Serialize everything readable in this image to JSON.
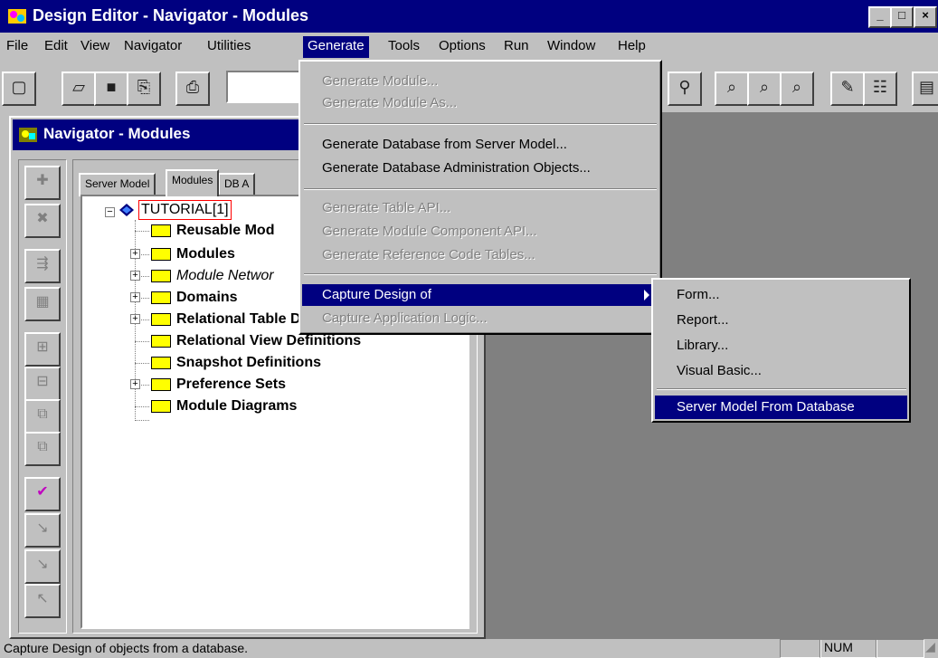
{
  "window": {
    "title": "Design Editor - Navigator - Modules",
    "caption_buttons": {
      "minimize": "_",
      "maximize": "□",
      "close": "×"
    }
  },
  "menubar": [
    {
      "label": "File"
    },
    {
      "label": "Edit"
    },
    {
      "label": "View"
    },
    {
      "label": "Navigator"
    },
    {
      "label": "Utilities"
    },
    {
      "label": "Generate"
    },
    {
      "label": "Tools"
    },
    {
      "label": "Options"
    },
    {
      "label": "Run"
    },
    {
      "label": "Window"
    },
    {
      "label": "Help"
    }
  ],
  "navigator": {
    "title": "Navigator - Modules",
    "tabs": [
      {
        "label": "Server Model"
      },
      {
        "label": "Modules"
      },
      {
        "label": "DB A"
      }
    ],
    "tree": {
      "root": "TUTORIAL[1]",
      "items": [
        {
          "label": "Reusable Mod"
        },
        {
          "label": "Modules"
        },
        {
          "label": "Module Networ"
        },
        {
          "label": "Domains"
        },
        {
          "label": "Relational Table Definitions"
        },
        {
          "label": "Relational View Definitions"
        },
        {
          "label": "Snapshot Definitions"
        },
        {
          "label": "Preference Sets"
        },
        {
          "label": "Module Diagrams"
        }
      ]
    }
  },
  "generate_menu": {
    "items": [
      {
        "label": "Generate Module...",
        "enabled": false
      },
      {
        "label": "Generate Module As...",
        "enabled": false
      },
      {
        "label": "Generate Database from Server Model...",
        "enabled": true
      },
      {
        "label": "Generate Database Administration Objects...",
        "enabled": true
      },
      {
        "label": "Generate Table API...",
        "enabled": false
      },
      {
        "label": "Generate Module Component API...",
        "enabled": false
      },
      {
        "label": "Generate Reference Code Tables...",
        "enabled": false
      },
      {
        "label": "Capture Design of",
        "enabled": true,
        "selected": true
      },
      {
        "label": "Capture Application Logic...",
        "enabled": false
      }
    ]
  },
  "capture_submenu": {
    "items": [
      {
        "label": "Form..."
      },
      {
        "label": "Report..."
      },
      {
        "label": "Library..."
      },
      {
        "label": "Visual Basic..."
      },
      {
        "label": "Server Model From Database",
        "selected": true
      }
    ]
  },
  "statusbar": {
    "text": "Capture Design of objects from a database.",
    "num": "NUM"
  },
  "colors": {
    "title_bar": "#000080",
    "face": "#c0c0c0",
    "highlight": "#000080",
    "folder": "#ffff00",
    "root_box": "#ff0000"
  },
  "icons": {
    "toolbar": [
      "new-icon",
      "open-icon",
      "save-icon",
      "save-as-icon",
      "print-icon",
      "zoom-icon",
      "find-icon",
      "find-next-icon",
      "find-prev-icon",
      "edit-icon",
      "properties-icon",
      "doc-icon"
    ],
    "vtoolbar": [
      "create-icon",
      "delete-icon",
      "cut-tree-icon",
      "copy-tree-icon",
      "expand-icon",
      "collapse-icon",
      "expand-all-icon",
      "collapse-all-icon",
      "check-in-icon",
      "check-out-icon",
      "next-icon",
      "previous-icon"
    ]
  }
}
